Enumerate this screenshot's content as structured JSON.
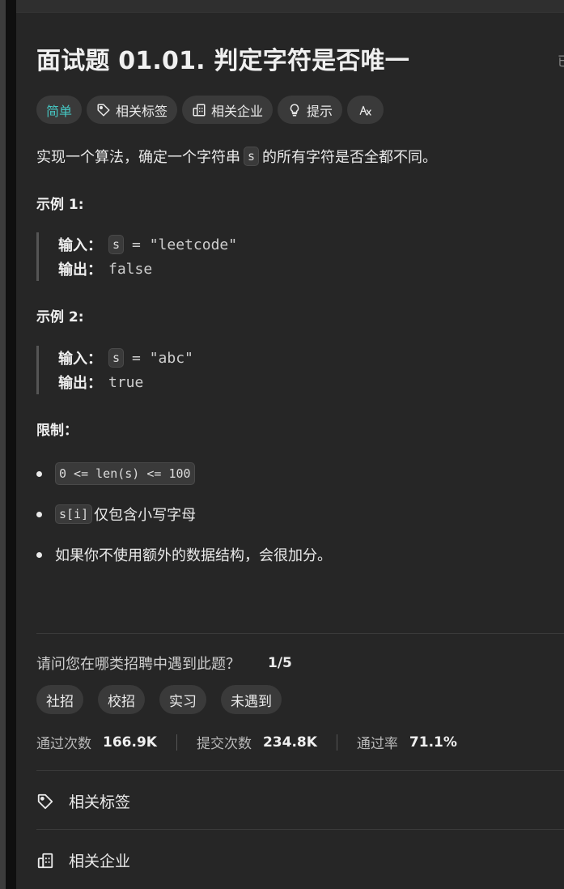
{
  "title": "面试题 01.01. 判定字符是否唯一",
  "title_overflow_char": "已",
  "tags": {
    "difficulty": "简单",
    "related_tags": "相关标签",
    "related_companies": "相关企业",
    "hints": "提示",
    "translate_icon": "translate-icon"
  },
  "description": {
    "before": "实现一个算法，确定一个字符串",
    "code": "s",
    "after": "的所有字符是否全都不同。"
  },
  "examples": [
    {
      "heading": "示例 1:",
      "input_label": "输入：",
      "input_code": "s",
      "input_rest": "= \"leetcode\"",
      "output_label": "输出：",
      "output_value": "false"
    },
    {
      "heading": "示例 2:",
      "input_label": "输入：",
      "input_code": "s",
      "input_rest": "= \"abc\"",
      "output_label": "输出：",
      "output_value": "true"
    }
  ],
  "constraints": {
    "heading": "限制：",
    "items": [
      {
        "code": "0 <= len(s) <= 100",
        "text": ""
      },
      {
        "code": "s[i]",
        "text": "仅包含小写字母"
      },
      {
        "code": "",
        "text": "如果你不使用额外的数据结构，会很加分。"
      }
    ]
  },
  "survey": {
    "question": "请问您在哪类招聘中遇到此题？",
    "progress": "1/5",
    "options": [
      "社招",
      "校招",
      "实习",
      "未遇到"
    ]
  },
  "stats": {
    "accepted_label": "通过次数",
    "accepted_value": "166.9K",
    "submissions_label": "提交次数",
    "submissions_value": "234.8K",
    "rate_label": "通过率",
    "rate_value": "71.1%"
  },
  "sections": {
    "related_tags": "相关标签",
    "related_companies": "相关企业"
  },
  "colors": {
    "easy": "#46c6c2",
    "panel_bg": "#262626",
    "chip_bg": "#3a3a3a"
  }
}
